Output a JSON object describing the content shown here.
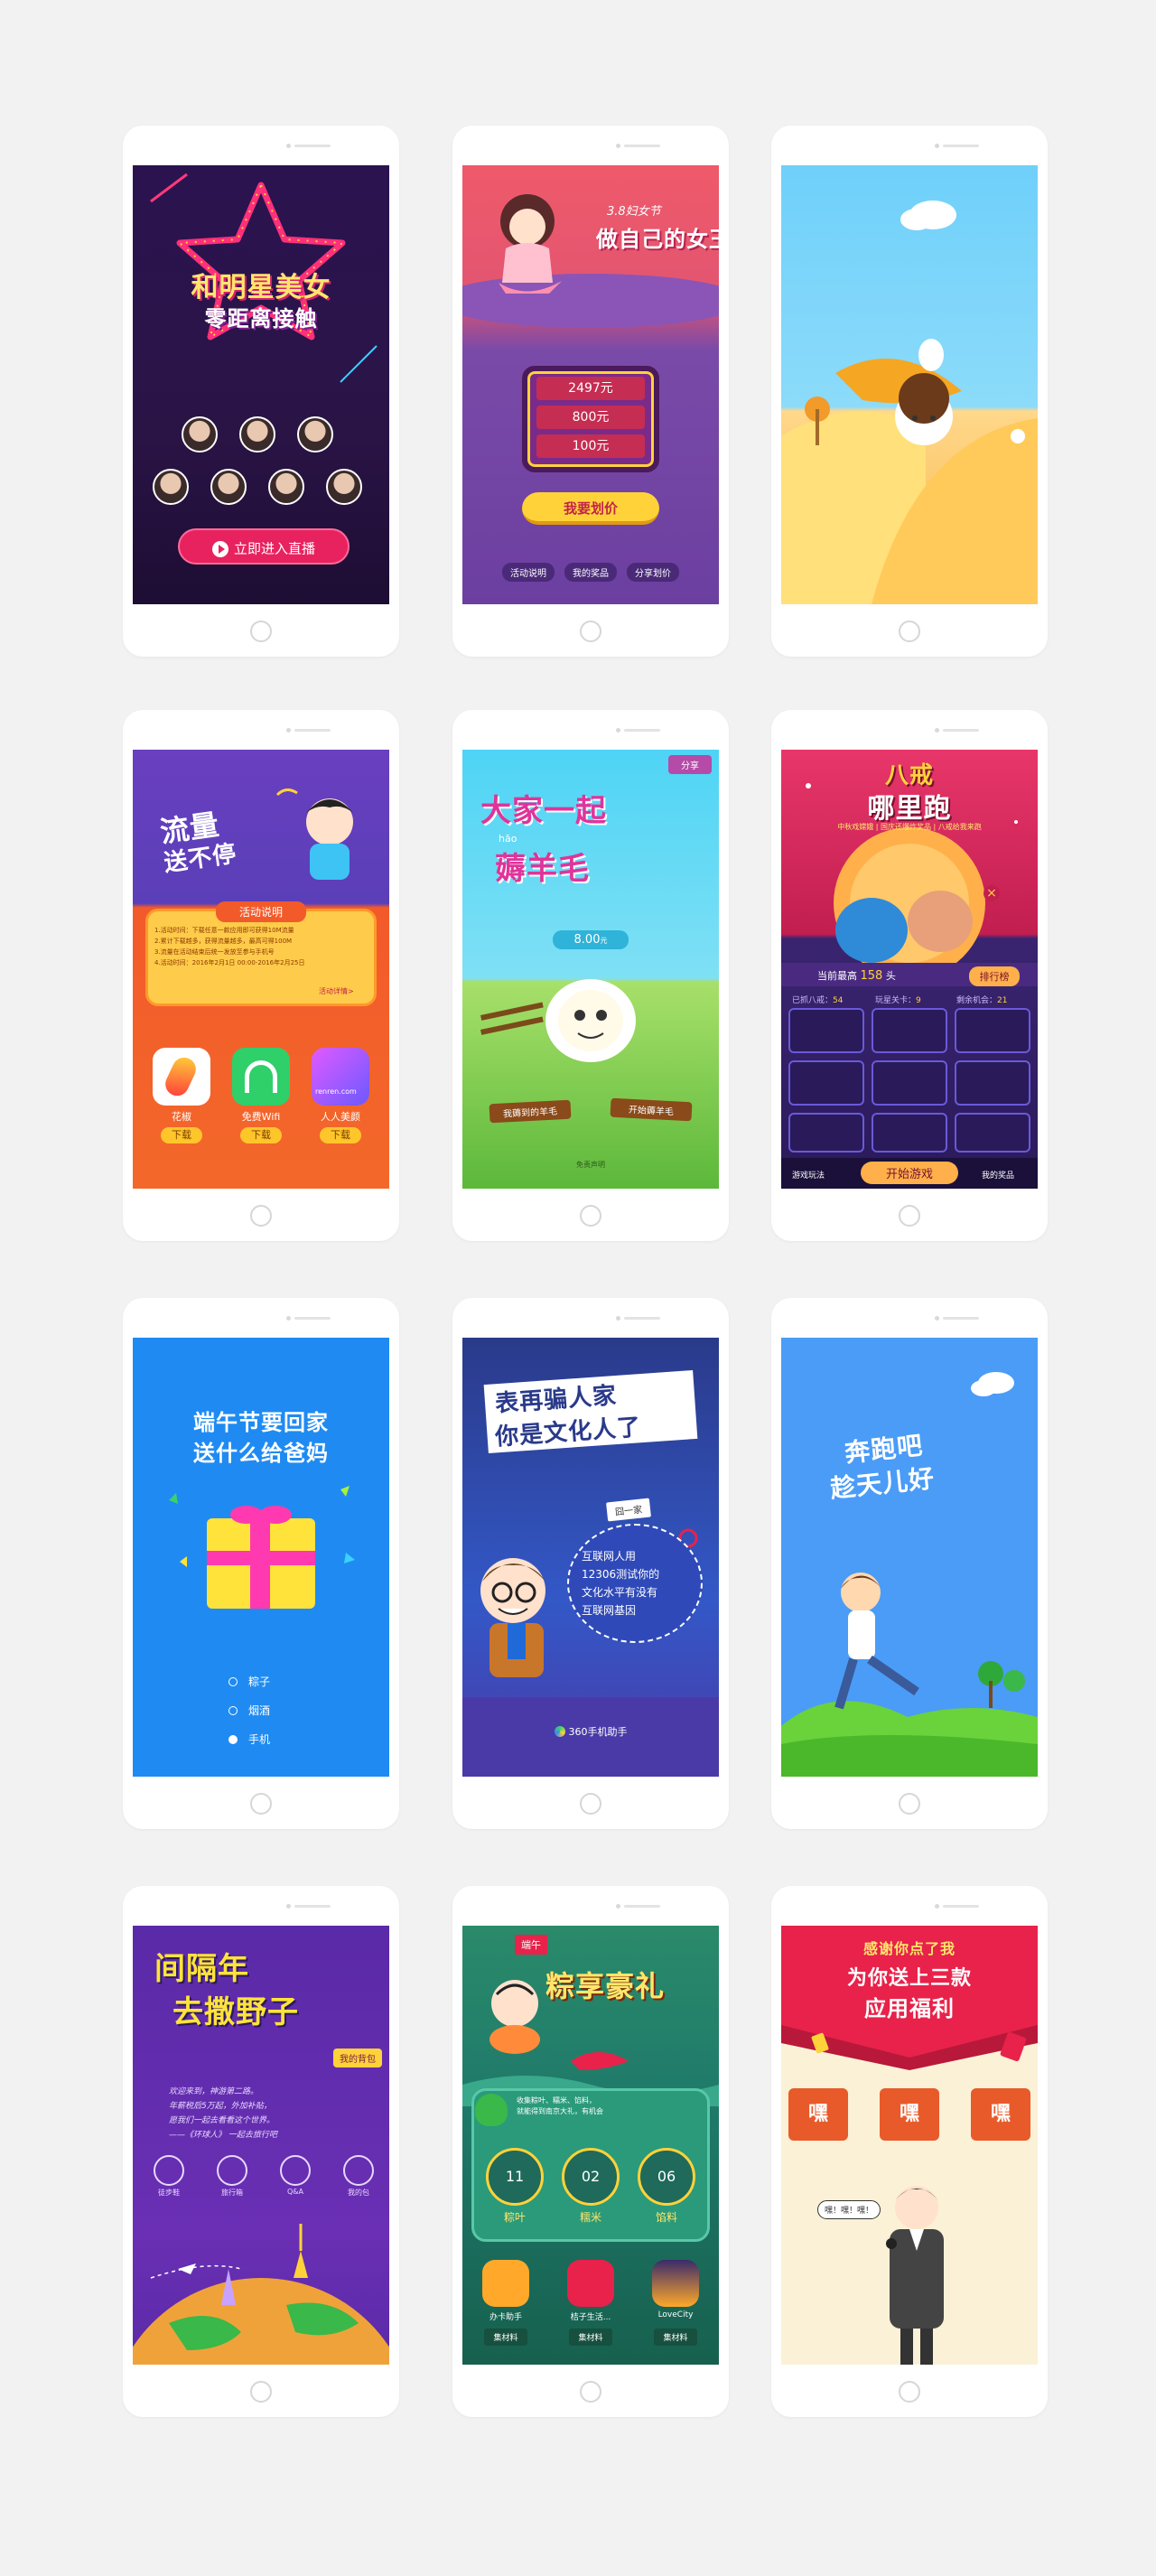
{
  "screens": {
    "s1": {
      "title_line1": "和明星美女",
      "title_line2": "零距离接触",
      "cta": "立即进入直播"
    },
    "s2": {
      "badge": "3.8妇女节",
      "title": "做自己的女王",
      "prices": [
        "2497元",
        "800元",
        "100元"
      ],
      "cta": "我要划价",
      "tabs": [
        "活动说明",
        "我的奖品",
        "分享划价"
      ]
    },
    "s4": {
      "title_line1": "流量",
      "title_line2": "送不停",
      "section_title": "活动说明",
      "rules": [
        "1.活动时间：下载任意一款应用即可获得10M流量",
        "2.累计下载越多，获得流量越多，最高可得100M",
        "3.流量在活动结束后统一发放至参与手机号",
        "4.活动时间：2016年2月1日 00:00-2016年2月25日"
      ],
      "rules_link": "活动详情>",
      "apps": [
        {
          "name": "花椒",
          "button": "下载"
        },
        {
          "name": "免费Wifi",
          "button": "下载"
        },
        {
          "name": "人人美颜",
          "button": "下载"
        }
      ],
      "app3_logo": "renren.com"
    },
    "s5": {
      "share": "分享",
      "title_line1": "大家一起",
      "pinyin": "hāo",
      "title_line2": "薅羊毛",
      "counter": "8.00",
      "counter_unit": "元",
      "sign_left": "我薅到的羊毛",
      "sign_right": "开始薅羊毛",
      "footer": "免责声明"
    },
    "s6": {
      "title_line1": "八戒",
      "title_line2": "哪里跑",
      "subtitle": "中秋戏嫦娥 | 国庆还爆炸奖品 | 八戒给我来跑",
      "close": "×",
      "high_score_label": "当前最高",
      "high_score_value": "158",
      "high_score_unit": "头",
      "rank_button": "排行榜",
      "caught_label": "已抓八戒：",
      "caught_value": "54",
      "level_label": "玩星关卡：",
      "level_value": "9",
      "left_label": "剩余机会：",
      "left_value": "21",
      "rules": "游戏玩法",
      "start": "开始游戏",
      "prizes": "我的奖品"
    },
    "s7": {
      "title_line1": "端午节要回家",
      "title_line2": "送什么给爸妈",
      "options": [
        "粽子",
        "烟酒",
        "手机"
      ],
      "selected_index": 2
    },
    "s8": {
      "title_line1": "表再骗人家",
      "title_line2": "你是文化人了",
      "tag": "囧一家",
      "bubble_lines": [
        "互联网人用",
        "12306测试你的",
        "文化水平有没有",
        "互联网基因"
      ],
      "logo": "360手机助手"
    },
    "s9": {
      "title_line1": "奔跑吧",
      "title_line2": "趁天儿好"
    },
    "s10": {
      "title_line1": "间隔年",
      "title_line2": "去撒野子",
      "bag_label": "我的背包",
      "text_lines": [
        "欢迎来到，神游第二路。",
        "年薪税后5万起，外加补贴，",
        "愿我们一起去看看这个世界。",
        "——《环球人》 一起去旅行吧"
      ],
      "icons": [
        "徒步鞋",
        "旅行箱",
        "Q&A",
        "我的包"
      ]
    },
    "s11": {
      "brand": "端午",
      "title": "粽享豪礼",
      "desc_lines": [
        "收集粽叶、糯米、馅料，",
        "就能得到南京大礼，有机会"
      ],
      "counters": [
        {
          "value": "11",
          "label": "粽叶"
        },
        {
          "value": "02",
          "label": "糯米"
        },
        {
          "value": "06",
          "label": "馅料"
        }
      ],
      "apps": [
        {
          "name": "办卡助手",
          "button": "集材料"
        },
        {
          "name": "桔子生活...",
          "button": "集材料"
        },
        {
          "name": "LoveCity",
          "button": "集材料"
        }
      ]
    },
    "s12": {
      "title_line1": "感谢你点了我",
      "title_line2": "为你送上三款",
      "title_line3": "应用福利",
      "boxes": [
        "嘿",
        "嘿",
        "嘿"
      ],
      "speech": "嘿！嘿！嘿！"
    }
  },
  "colors": {
    "page_bg": "#f2f2f2",
    "s1_bg": "#2a1446",
    "s2_bg": "#6b3fa0",
    "s3_sky": "#7fd2f7",
    "s4_bg": "#f35a2a",
    "s5_sky": "#5dd7f2",
    "s6_bg": "#3a2470",
    "s7_bg": "#1f8bf2",
    "s8_bg": "#3358c7",
    "s9_bg": "#4a9cf7",
    "s10_bg": "#6a2fb4",
    "s11_bg": "#1f7a6a",
    "s12_bg": "#fbf1d6"
  }
}
